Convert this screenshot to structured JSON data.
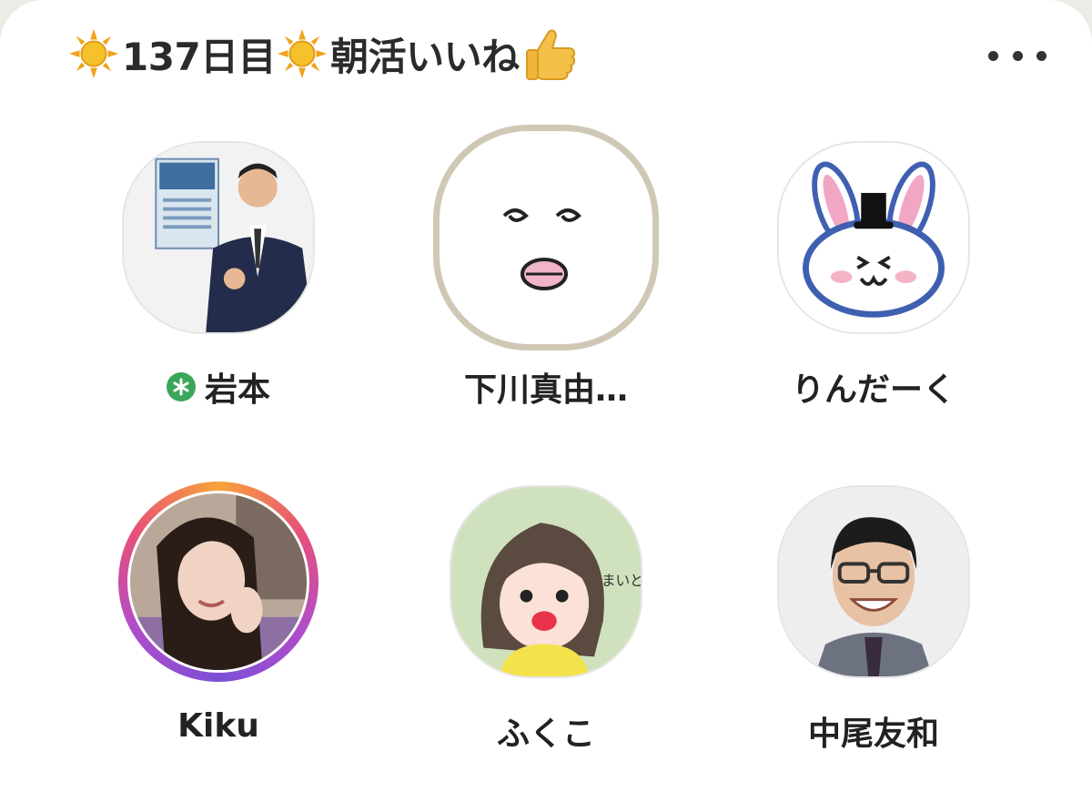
{
  "header": {
    "title_day": "137日目",
    "title_main": "朝活いいね",
    "icons": [
      "sun-icon",
      "sun-icon",
      "thumbs-up-icon"
    ]
  },
  "menu": {
    "icon": "more-dots-icon"
  },
  "members": [
    {
      "name": "岩本",
      "badge": "asterisk-badge-icon",
      "badge_color": "#3aa65a"
    },
    {
      "name": "下川真由…",
      "ring_color": "#cfc8b5"
    },
    {
      "name": "りんだーく"
    },
    {
      "name": "Kiku",
      "ring": "gradient"
    },
    {
      "name": "ふくこ"
    },
    {
      "name": "中尾友和"
    }
  ]
}
